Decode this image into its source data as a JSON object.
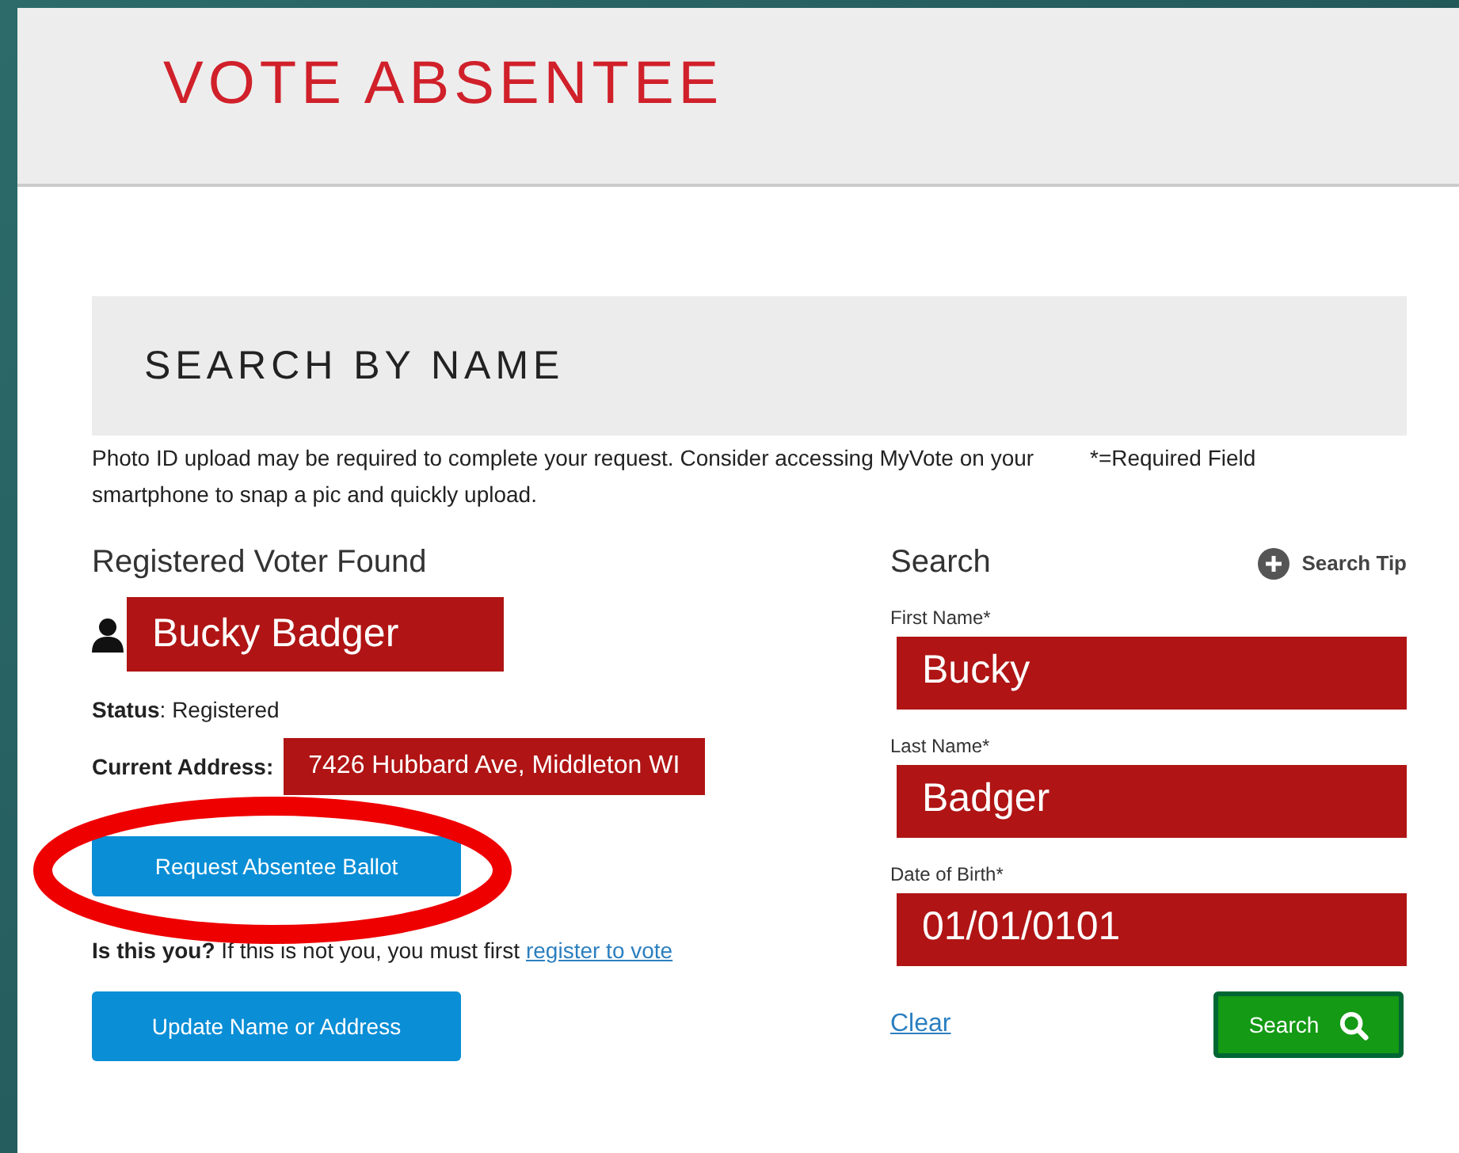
{
  "header": {
    "title": "VOTE ABSENTEE"
  },
  "section": {
    "title": "SEARCH BY NAME",
    "notice": "Photo ID upload may be required to complete your request. Consider accessing MyVote on your smartphone to snap a pic and quickly upload.",
    "required_note": "*=Required Field"
  },
  "voter": {
    "heading": "Registered Voter Found",
    "name": "Bucky Badger",
    "status_label": "Status",
    "status": ": Registered",
    "address_label": "Current Address:",
    "address": "7426 Hubbard Ave, Middleton WI",
    "request_button": "Request Absentee Ballot",
    "confirm": "**Is this you?** If this is not you, you must first",
    "register_link": "register to vote",
    "update_button": "Update Name or Address"
  },
  "annotation": {
    "kind": "ellipse"
  },
  "search": {
    "heading": "Search",
    "tip": "Search Tip",
    "fields": [
      {
        "label": "First Name*",
        "value": "Bucky"
      },
      {
        "label": "Last Name*",
        "value": "Badger"
      },
      {
        "label": "Date of Birth*",
        "value": "01/01/0101"
      }
    ],
    "clear_link": "Clear",
    "search_button": "Search"
  }
}
